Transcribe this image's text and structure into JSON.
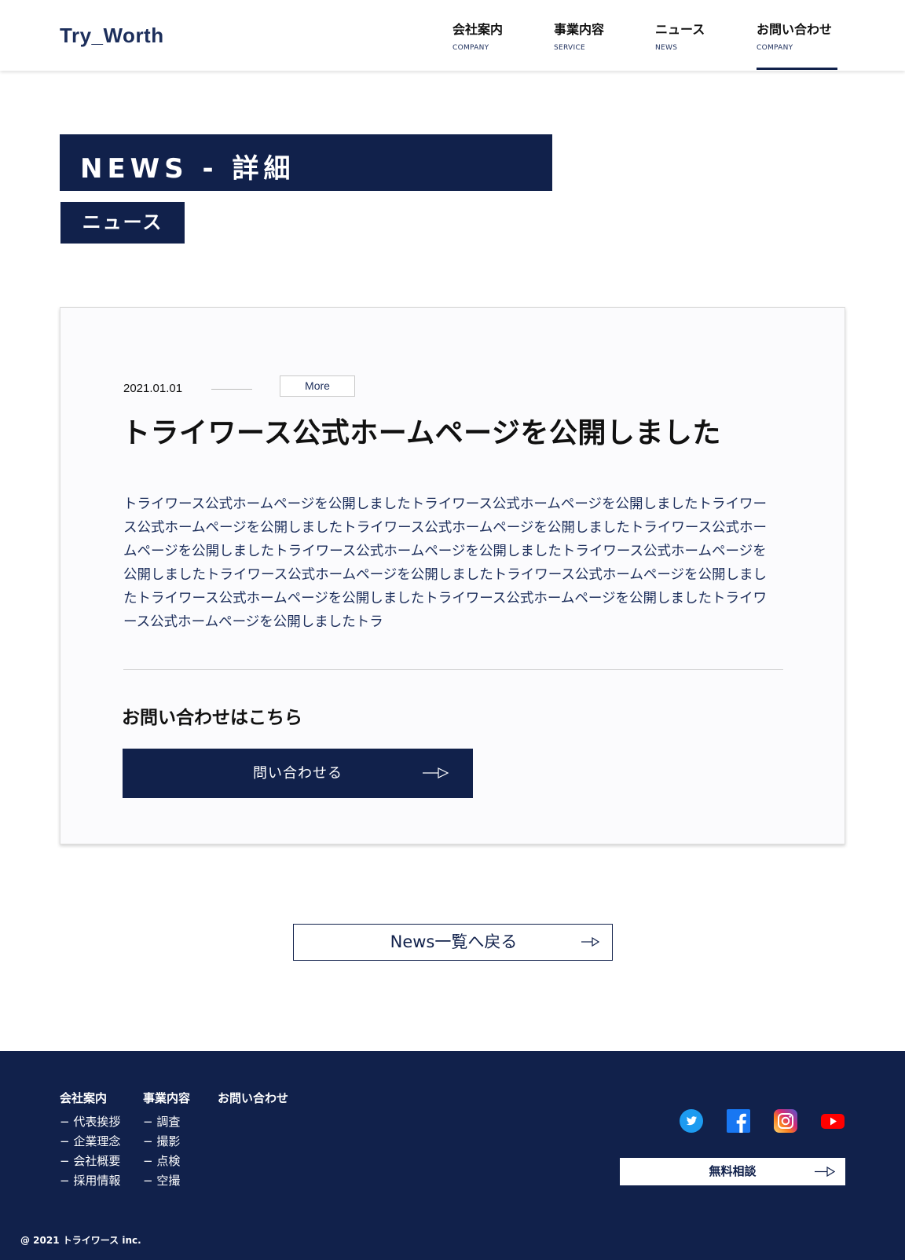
{
  "header": {
    "logo": "Try_Worth",
    "nav": [
      {
        "jp": "会社案内",
        "en": "COMPANY"
      },
      {
        "jp": "事業内容",
        "en": "SERVICE"
      },
      {
        "jp": "ニュース",
        "en": "NEWS"
      },
      {
        "jp": "お問い合わせ",
        "en": "COMPANY"
      }
    ]
  },
  "page": {
    "title": "NEWS - 詳細",
    "category": "ニュース"
  },
  "article": {
    "date": "2021.01.01",
    "more_label": "More",
    "title": "トライワース公式ホームページを公開しました",
    "body": "トライワース公式ホームページを公開しましたトライワース公式ホームページを公開しましたトライワース公式ホームページを公開しましたトライワース公式ホームページを公開しましたトライワース公式ホームページを公開しましたトライワース公式ホームページを公開しましたトライワース公式ホームページを公開しましたトライワース公式ホームページを公開しましたトライワース公式ホームページを公開しましたトライワース公式ホームページを公開しましたトライワース公式ホームページを公開しましたトライワース公式ホームページを公開しましたトラ",
    "contact_heading": "お問い合わせはこちら",
    "contact_button": "問い合わせる"
  },
  "back_button": "News一覧へ戻る",
  "footer": {
    "columns": [
      {
        "head": "会社案内",
        "links": [
          "− 代表挨拶",
          "− 企業理念",
          "− 会社概要",
          "− 採用情報"
        ]
      },
      {
        "head": "事業内容",
        "links": [
          "− 調査",
          "− 撮影",
          "− 点検",
          "− 空撮"
        ]
      },
      {
        "head": "お問い合わせ",
        "links": []
      }
    ],
    "social": [
      "twitter-icon",
      "facebook-icon",
      "instagram-icon",
      "youtube-icon"
    ],
    "free_consult": "無料相談",
    "copyright": "@ 2021 トライワース inc."
  },
  "colors": {
    "navy": "#11214b",
    "card_bg": "#fbfbfd"
  }
}
